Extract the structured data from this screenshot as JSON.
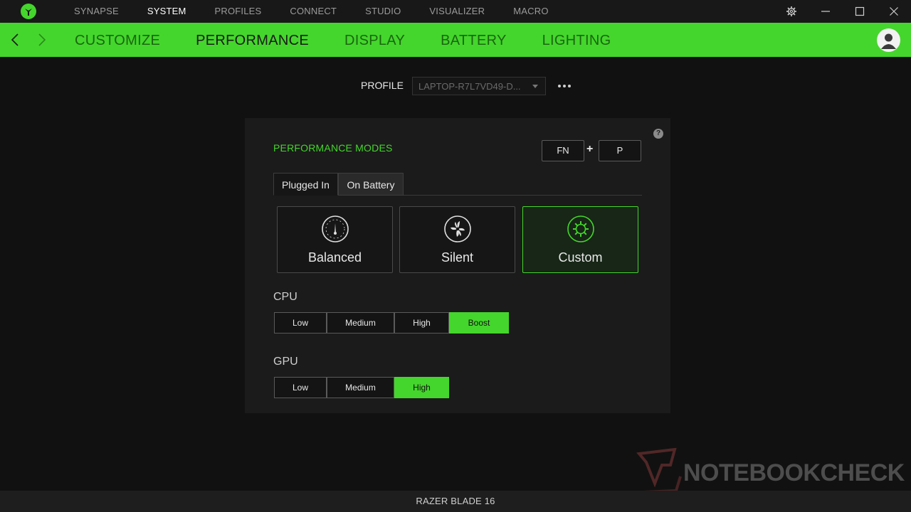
{
  "app": {
    "top_nav": [
      "SYNAPSE",
      "SYSTEM",
      "PROFILES",
      "CONNECT",
      "STUDIO",
      "VISUALIZER",
      "MACRO"
    ],
    "active_top_nav": "SYSTEM",
    "sub_nav": [
      "CUSTOMIZE",
      "PERFORMANCE",
      "DISPLAY",
      "BATTERY",
      "LIGHTING"
    ],
    "active_sub_nav": "PERFORMANCE",
    "accent_color": "#44d62c",
    "icons": [
      "razer-logo-icon",
      "settings-gear-icon",
      "minimize-icon",
      "maximize-icon",
      "close-icon",
      "back-arrow-icon",
      "forward-arrow-icon",
      "user-avatar-icon"
    ]
  },
  "profile": {
    "label": "PROFILE",
    "selected": "LAPTOP-R7L7VD49-D..."
  },
  "performance": {
    "title": "PERFORMANCE MODES",
    "shortcut": {
      "key1": "FN",
      "plus": "+",
      "key2": "P"
    },
    "help": "?",
    "tabs": [
      "Plugged In",
      "On Battery"
    ],
    "active_tab": "Plugged In",
    "modes": [
      {
        "label": "Balanced",
        "icon": "gauge-icon"
      },
      {
        "label": "Silent",
        "icon": "fan-icon"
      },
      {
        "label": "Custom",
        "icon": "gear-icon"
      }
    ],
    "active_mode": "Custom",
    "cpu": {
      "label": "CPU",
      "options": [
        "Low",
        "Medium",
        "High",
        "Boost"
      ],
      "selected": "Boost"
    },
    "gpu": {
      "label": "GPU",
      "options": [
        "Low",
        "Medium",
        "High"
      ],
      "selected": "High"
    }
  },
  "status": {
    "device": "RAZER BLADE 16"
  },
  "watermark": "NOTEBOOKCHECK"
}
